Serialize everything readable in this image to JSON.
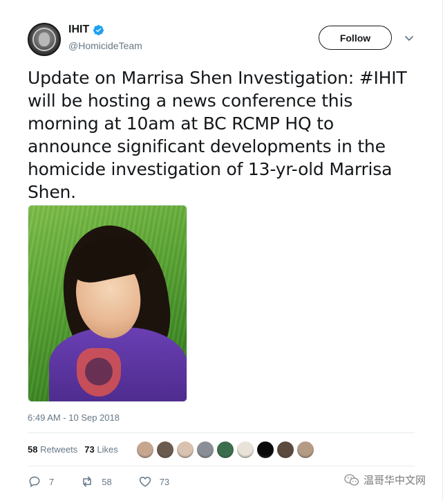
{
  "user": {
    "display_name": "IHIT",
    "handle": "@HomicideTeam",
    "verified": true
  },
  "follow_label": "Follow",
  "tweet": {
    "text": "Update on Marrisa Shen Investigation:  #IHIT will be hosting a news conference this morning at 10am at BC RCMP HQ to announce significant developments in the homicide investigation of 13-yr-old Marrisa Shen.",
    "timestamp": "6:49 AM - 10 Sep 2018"
  },
  "stats": {
    "retweets_count": "58",
    "retweets_label": "Retweets",
    "likes_count": "73",
    "likes_label": "Likes"
  },
  "likers": [
    "#c7a690",
    "#6b5a4e",
    "#d9c2b0",
    "#8a8f97",
    "#3b6e4d",
    "#e8e2d8",
    "#0a0a0a",
    "#5d4a3e",
    "#b59a84"
  ],
  "actions": {
    "reply_count": "7",
    "retweet_count": "58",
    "like_count": "73"
  },
  "watermark": "温哥华中文网",
  "colors": {
    "accent": "#1da1f2",
    "text": "#14171a",
    "muted": "#657786"
  }
}
